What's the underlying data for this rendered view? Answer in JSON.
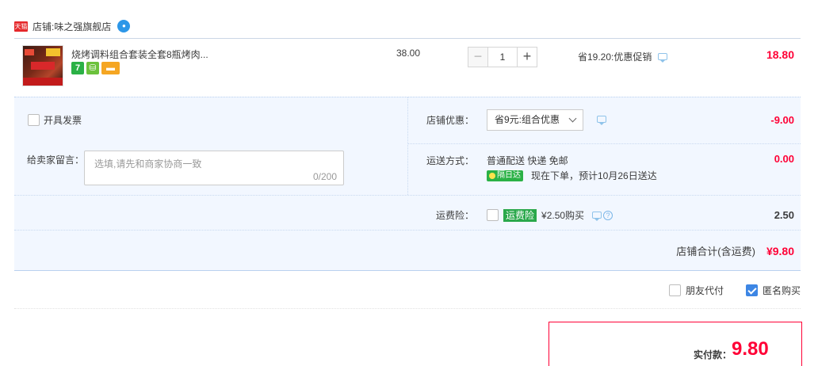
{
  "store": {
    "tmall_badge": "天猫",
    "label": "店铺:",
    "name": "味之强旗舰店"
  },
  "item": {
    "title": "烧烤调料组合套装全套8瓶烤肉...",
    "badge_seven": "7",
    "unit_price": "38.00",
    "quantity": "1",
    "minus": "−",
    "plus": "+",
    "promotion": "省19.20:优惠促销",
    "subtotal": "18.80"
  },
  "invoice": {
    "label": "开具发票"
  },
  "message": {
    "label": "给卖家留言：",
    "placeholder": "选填,请先和商家协商一致",
    "counter": "0/200"
  },
  "store_discount": {
    "label": "店铺优惠：",
    "selected": "省9元:组合优惠",
    "amount": "-9.00"
  },
  "shipping": {
    "label": "运送方式：",
    "method": "普通配送 快递 免邮",
    "nextday_tag": "隔日达",
    "eta": "现在下单，预计10月26日送达",
    "amount": "0.00"
  },
  "insurance": {
    "label": "运费险：",
    "tag": "运费险",
    "price": "¥2.50购买",
    "help": "?",
    "amount": "2.50"
  },
  "store_total": {
    "label": "店铺合计(含运费)",
    "value": "¥9.80"
  },
  "options": {
    "friend_pay": "朋友代付",
    "anonymous": "匿名购买",
    "anonymous_checked": true
  },
  "payment": {
    "label": "实付款：",
    "value": "9.80"
  },
  "colors": {
    "price_red": "#ff0036",
    "panel_bg": "#f2f7ff",
    "accent_blue": "#3d86e4"
  }
}
